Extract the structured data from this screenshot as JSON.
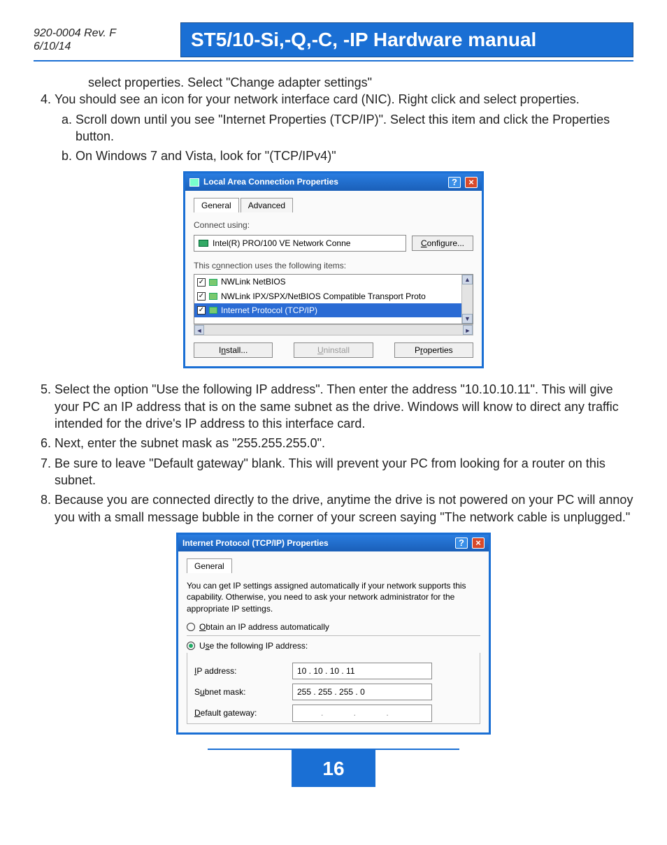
{
  "header": {
    "rev_line1": "920-0004 Rev. F",
    "rev_line2": "6/10/14",
    "title": "ST5/10-Si,-Q,-C, -IP Hardware manual"
  },
  "body": {
    "lead_in": "select properties.  Select \"Change adapter settings\"",
    "step4": "You should see an icon for your network interface card (NIC).  Right click and select properties.",
    "step4a": "Scroll down until you see \"Internet Properties (TCP/IP)\".  Select this item and click the Properties button.",
    "step4b": "On Windows 7 and Vista, look for \"(TCP/IPv4)\"",
    "step5": "Select the option \"Use the following IP address\".  Then enter the address \"10.10.10.11\".  This will give your PC an IP address that is on the same subnet as the drive.  Windows will know to direct any traffic intended for the drive's IP address to this interface card.",
    "step6": "Next, enter the subnet mask as \"255.255.255.0\".",
    "step7": "Be sure to leave \"Default gateway\" blank.  This will prevent your PC from looking for a router on this subnet.",
    "step8": "Because you are connected directly to the drive, anytime the drive is not powered on your PC will annoy you with a small message bubble in the corner of your screen saying \"The network cable is unplugged.\""
  },
  "dialog1": {
    "title": "Local Area Connection Properties",
    "tab_general": "General",
    "tab_advanced": "Advanced",
    "connect_using_label": "Connect using:",
    "nic_name": "Intel(R) PRO/100 VE Network Conne",
    "configure_btn": "Configure...",
    "items_label": "This connection uses the following items:",
    "items": [
      "NWLink NetBIOS",
      "NWLink IPX/SPX/NetBIOS Compatible Transport Proto",
      "Internet Protocol (TCP/IP)"
    ],
    "install_btn": "Install...",
    "uninstall_btn": "Uninstall",
    "properties_btn": "Properties"
  },
  "dialog2": {
    "title": "Internet Protocol (TCP/IP) Properties",
    "tab_general": "General",
    "explain": "You can get IP settings assigned automatically if your network supports this capability. Otherwise, you need to ask your network administrator for the appropriate IP settings.",
    "radio_auto": "Obtain an IP address automatically",
    "radio_manual": "Use the following IP address:",
    "ip_label": "IP address:",
    "ip_value": "10 . 10 . 10 . 11",
    "mask_label": "Subnet mask:",
    "mask_value": "255 . 255 . 255 .  0",
    "gw_label": "Default gateway:",
    "gw_value": ".      .      ."
  },
  "page_number": "16"
}
